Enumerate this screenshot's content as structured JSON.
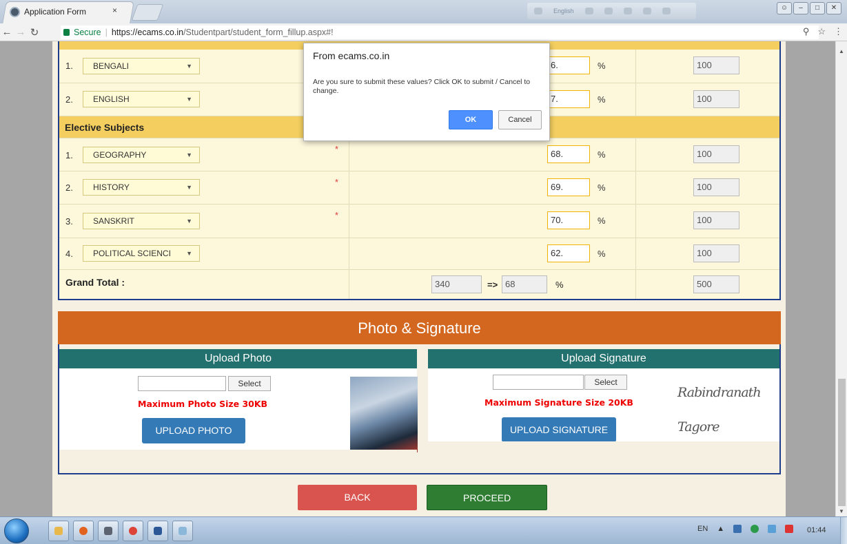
{
  "browser": {
    "tab_title": "Application Form",
    "tab_close": "×",
    "extension_label": "English",
    "secure_label": "Secure",
    "url_scheme_host": "https://ecams.co.in",
    "url_path": "/Studentpart/student_form_fillup.aspx#!",
    "zoom_icon": "zoom-icon",
    "star_icon": "star-icon",
    "menu_icon": "menu-dots-icon"
  },
  "form": {
    "elective_header": "Elective Subjects",
    "compulsory_rows": [
      {
        "num": "1.",
        "subject": "BENGALI",
        "pct": "6.",
        "pct_sign": "%",
        "full": "100"
      },
      {
        "num": "2.",
        "subject": "ENGLISH",
        "pct": "7.",
        "pct_sign": "%",
        "full": "100"
      }
    ],
    "elective_rows": [
      {
        "num": "1.",
        "subject": "GEOGRAPHY",
        "required": "*",
        "pct": "68.",
        "pct_sign": "%",
        "full": "100"
      },
      {
        "num": "2.",
        "subject": "HISTORY",
        "required": "*",
        "pct": "69.",
        "pct_sign": "%",
        "full": "100"
      },
      {
        "num": "3.",
        "subject": "SANSKRIT",
        "required": "*",
        "pct": "70.",
        "pct_sign": "%",
        "full": "100"
      },
      {
        "num": "4.",
        "subject": "POLITICAL SCIENCI",
        "pct": "62.",
        "pct_sign": "%",
        "full": "100"
      }
    ],
    "grand_total": {
      "label": "Grand Total :",
      "total": "340",
      "arrow": "=>",
      "pct": "68",
      "pct_sign": "%",
      "full": "500"
    }
  },
  "photo_signature": {
    "header": "Photo & Signature",
    "photo": {
      "title": "Upload Photo",
      "select_label": "Select",
      "max_note": "Maximum Photo Size 30KB",
      "upload_label": "UPLOAD PHOTO"
    },
    "signature": {
      "title": "Upload Signature",
      "select_label": "Select",
      "max_note": "Maximum Signature Size 20KB",
      "upload_label": "UPLOAD SIGNATURE",
      "signature_text": "Rabindranath Tagore"
    }
  },
  "actions": {
    "back_label": "BACK",
    "proceed_label": "PROCEED"
  },
  "dialog": {
    "title": "From ecams.co.in",
    "message": "Are you sure to submit these values? Click OK to submit / Cancel to change.",
    "ok_label": "OK",
    "cancel_label": "Cancel"
  },
  "taskbar": {
    "language": "EN",
    "clock": "01:44"
  },
  "colors": {
    "header_orange": "#d3671f",
    "pane_teal": "#22716e",
    "table_border": "#1e3c8c",
    "back_red": "#d9534f",
    "proceed_green": "#2e7d32",
    "upload_blue": "#337ab7"
  }
}
